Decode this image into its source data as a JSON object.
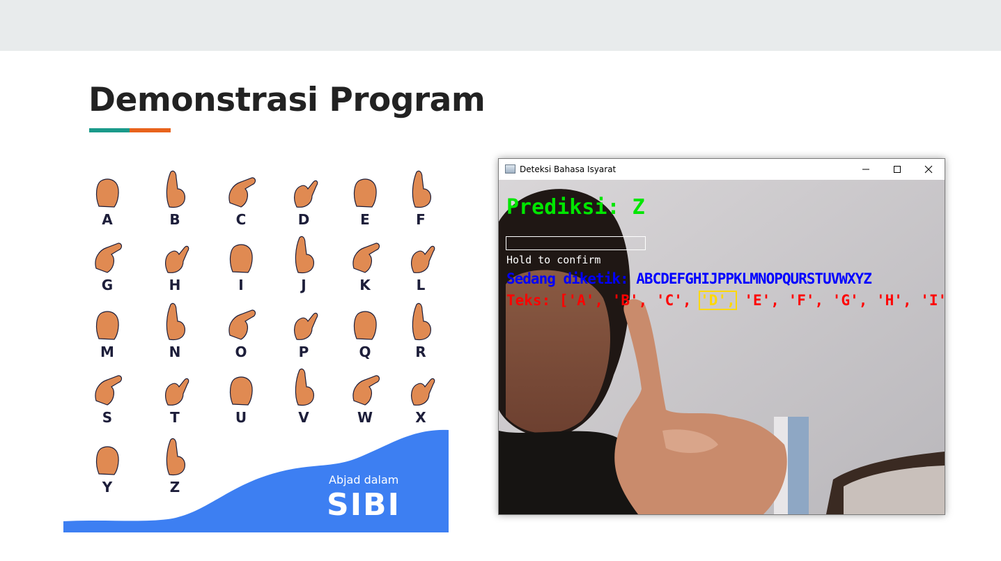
{
  "slide": {
    "title": "Demonstrasi Program",
    "accent_colors": [
      "#1a9a8a",
      "#e8631c"
    ]
  },
  "poster": {
    "letters": [
      "A",
      "B",
      "C",
      "D",
      "E",
      "F",
      "G",
      "H",
      "I",
      "J",
      "K",
      "L",
      "M",
      "N",
      "O",
      "P",
      "Q",
      "R",
      "S",
      "T",
      "U",
      "V",
      "W",
      "X",
      "Y",
      "Z"
    ],
    "brand_small": "Abjad dalam",
    "brand_big": "SIBI",
    "wave_color": "#3d7ff2",
    "hand_color": "#e08a52"
  },
  "window": {
    "title": "Deteksi Bahasa Isyarat",
    "minimize_icon": "minimize-icon",
    "maximize_icon": "maximize-icon",
    "close_icon": "close-icon"
  },
  "overlay": {
    "prediction": "Prediksi: Z",
    "hold_text": "Hold to confirm",
    "typed": "Sedang diketik: ABCDEFGHIJPPKLMNOPQURSTUVWXYZ",
    "teks_prefix": "Teks: ['A', 'B', 'C', ",
    "teks_selected": "'D',",
    "teks_suffix": " 'E', 'F', 'G', 'H', 'I', 'J']"
  }
}
